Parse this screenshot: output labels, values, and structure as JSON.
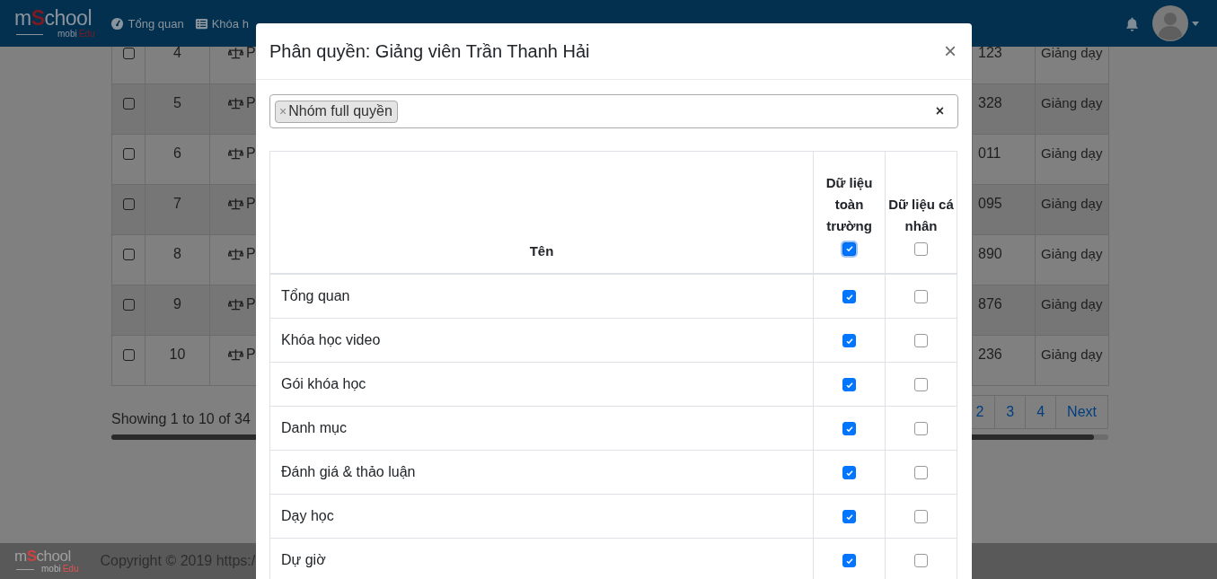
{
  "navbar": {
    "logo": {
      "prefix": "m",
      "accent": "S",
      "suffix": "chool",
      "tagline": "mobi",
      "tagline_accent": "Edu"
    },
    "items": [
      {
        "label": "Tổng quan",
        "kind": "dashboard"
      },
      {
        "label": "Khóa h",
        "kind": "courses"
      }
    ]
  },
  "background_table": {
    "rows": [
      {
        "checked": false,
        "number": "4",
        "name": "P",
        "phone": "123",
        "role": "Giảng dạy"
      },
      {
        "checked": false,
        "number": "5",
        "name": "P",
        "phone": "328",
        "role": "Giảng dạy"
      },
      {
        "checked": false,
        "number": "6",
        "name": "P",
        "phone": "011",
        "role": "Giảng dạy"
      },
      {
        "checked": false,
        "number": "7",
        "name": "P",
        "phone": "095",
        "role": "Giảng dạy"
      },
      {
        "checked": false,
        "number": "8",
        "name": "P",
        "phone": "890",
        "role": "Giảng dạy"
      },
      {
        "checked": false,
        "number": "9",
        "name": "P",
        "phone": "876",
        "role": "Giảng dạy"
      },
      {
        "checked": false,
        "number": "10",
        "name": "P",
        "phone": "236",
        "role": "Giảng dạy"
      }
    ],
    "info": "Showing 1 to 10 of 34",
    "pagination": [
      "2",
      "3",
      "4",
      "Next"
    ]
  },
  "footer": {
    "logo": {
      "prefix": "m",
      "accent": "S",
      "suffix": "chool",
      "tagline": "mobi",
      "tagline_accent": "Edu"
    },
    "copyright": "Copyright © 2019 https:/"
  },
  "modal": {
    "title": "Phân quyền: Giảng viên Trần Thanh Hải",
    "close": "×",
    "select": {
      "tags": [
        {
          "label": "Nhóm full quyền",
          "remove": "×"
        }
      ],
      "clear": "×"
    },
    "columns": [
      {
        "label": "Tên"
      },
      {
        "label": "Dữ liệu toàn trường",
        "checked": true
      },
      {
        "label": "Dữ liệu cá nhân",
        "checked": false
      }
    ],
    "rows": [
      {
        "name": "Tổng quan",
        "school": true,
        "personal": false
      },
      {
        "name": "Khóa học video",
        "school": true,
        "personal": false
      },
      {
        "name": "Gói khóa học",
        "school": true,
        "personal": false
      },
      {
        "name": "Danh mục",
        "school": true,
        "personal": false
      },
      {
        "name": "Đánh giá & thảo luận",
        "school": true,
        "personal": false
      },
      {
        "name": "Dạy học",
        "school": true,
        "personal": false
      },
      {
        "name": "Dự giờ",
        "school": true,
        "personal": false
      }
    ]
  }
}
